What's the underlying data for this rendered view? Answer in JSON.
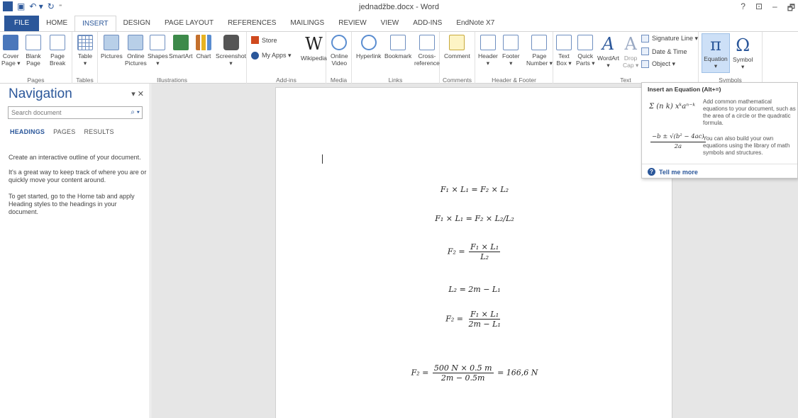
{
  "window": {
    "title": "jednadžbe.docx - Word",
    "controls": [
      "?",
      "⊡",
      "–",
      "🗗"
    ]
  },
  "tabs": [
    "FILE",
    "HOME",
    "INSERT",
    "DESIGN",
    "PAGE LAYOUT",
    "REFERENCES",
    "MAILINGS",
    "REVIEW",
    "VIEW",
    "ADD-INS",
    "EndNote X7"
  ],
  "ribbon": {
    "groups": {
      "pages": "Pages",
      "tables": "Tables",
      "illustrations": "Illustrations",
      "addins": "Add-ins",
      "media": "Media",
      "links": "Links",
      "comments": "Comments",
      "header_footer": "Header & Footer",
      "text": "Text",
      "symbols": "Symbols"
    },
    "buttons": {
      "cover_page": "Cover\nPage ▾",
      "blank_page": "Blank\nPage",
      "page_break": "Page\nBreak",
      "table": "Table\n▾",
      "pictures": "Pictures",
      "online_pictures": "Online\nPictures",
      "shapes": "Shapes\n▾",
      "smartart": "SmartArt",
      "chart": "Chart",
      "screenshot": "Screenshot\n▾",
      "store": "Store",
      "my_apps": "My Apps ▾",
      "wikipedia": "Wikipedia",
      "online_video": "Online\nVideo",
      "hyperlink": "Hyperlink",
      "bookmark": "Bookmark",
      "cross_reference": "Cross-\nreference",
      "comment": "Comment",
      "header": "Header\n▾",
      "footer": "Footer\n▾",
      "page_number": "Page\nNumber ▾",
      "text_box": "Text\nBox ▾",
      "quick_parts": "Quick\nParts ▾",
      "wordart": "WordArt\n▾",
      "drop_cap": "Drop\nCap ▾",
      "signature_line": "Signature Line ▾",
      "date_time": "Date & Time",
      "object": "Object ▾",
      "equation": "Equation\n▾",
      "symbol": "Symbol\n▾",
      "equation_glyph": "π",
      "symbol_glyph": "Ω",
      "wiki_glyph": "W"
    }
  },
  "navigation": {
    "title": "Navigation",
    "search_placeholder": "Search document",
    "tabs": [
      "HEADINGS",
      "PAGES",
      "RESULTS"
    ],
    "paragraphs": [
      "Create an interactive outline of your document.",
      "It's a great way to keep track of where you are or quickly move your content around.",
      "To get started, go to the Home tab and apply Heading styles to the headings in your document."
    ]
  },
  "document": {
    "eq1": "F₁ × L₁ = F₂ × L₂",
    "eq2": "F₁ × L₁ = F₂ × L₂/L₂",
    "eq3_lhs": "F₂ =",
    "eq3_num": "F₁ × L₁",
    "eq3_den": "L₂",
    "eq4": "L₂ = 2m − L₁",
    "eq5_lhs": "F₂ =",
    "eq5_num": "F₁ × L₁",
    "eq5_den": "2m − L₁",
    "eq6_lhs": "F₂ =",
    "eq6_num": "500 N × 0.5 m",
    "eq6_den": "2m − 0.5m",
    "eq6_rhs": "= 166,6 N"
  },
  "tooltip": {
    "title": "Insert an Equation (Alt+=)",
    "text1": "Add common mathematical equations to your document, such as the area of a circle or the quadratic formula.",
    "text2": "You can also build your own equations using the library of math symbols and structures.",
    "sample1": "Σ (n k) xᵏaⁿ⁻ᵏ",
    "sample2_num": "−b ± √(b² − 4ac)",
    "sample2_den": "2a",
    "more": "Tell me more"
  }
}
